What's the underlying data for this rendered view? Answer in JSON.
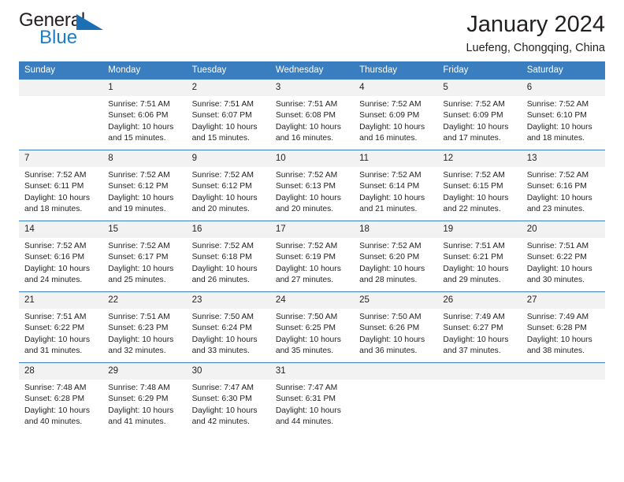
{
  "brand": {
    "name_part1": "General",
    "name_part2": "Blue",
    "accent_color": "#1f7dc4"
  },
  "header": {
    "title": "January 2024",
    "subtitle": "Luefeng, Chongqing, China"
  },
  "calendar": {
    "header_bg": "#3a7ebf",
    "daynum_bg": "#f2f2f2",
    "weekdays": [
      "Sunday",
      "Monday",
      "Tuesday",
      "Wednesday",
      "Thursday",
      "Friday",
      "Saturday"
    ],
    "weeks": [
      [
        {
          "day": "",
          "sunrise": "",
          "sunset": "",
          "daylight1": "",
          "daylight2": ""
        },
        {
          "day": "1",
          "sunrise": "Sunrise: 7:51 AM",
          "sunset": "Sunset: 6:06 PM",
          "daylight1": "Daylight: 10 hours",
          "daylight2": "and 15 minutes."
        },
        {
          "day": "2",
          "sunrise": "Sunrise: 7:51 AM",
          "sunset": "Sunset: 6:07 PM",
          "daylight1": "Daylight: 10 hours",
          "daylight2": "and 15 minutes."
        },
        {
          "day": "3",
          "sunrise": "Sunrise: 7:51 AM",
          "sunset": "Sunset: 6:08 PM",
          "daylight1": "Daylight: 10 hours",
          "daylight2": "and 16 minutes."
        },
        {
          "day": "4",
          "sunrise": "Sunrise: 7:52 AM",
          "sunset": "Sunset: 6:09 PM",
          "daylight1": "Daylight: 10 hours",
          "daylight2": "and 16 minutes."
        },
        {
          "day": "5",
          "sunrise": "Sunrise: 7:52 AM",
          "sunset": "Sunset: 6:09 PM",
          "daylight1": "Daylight: 10 hours",
          "daylight2": "and 17 minutes."
        },
        {
          "day": "6",
          "sunrise": "Sunrise: 7:52 AM",
          "sunset": "Sunset: 6:10 PM",
          "daylight1": "Daylight: 10 hours",
          "daylight2": "and 18 minutes."
        }
      ],
      [
        {
          "day": "7",
          "sunrise": "Sunrise: 7:52 AM",
          "sunset": "Sunset: 6:11 PM",
          "daylight1": "Daylight: 10 hours",
          "daylight2": "and 18 minutes."
        },
        {
          "day": "8",
          "sunrise": "Sunrise: 7:52 AM",
          "sunset": "Sunset: 6:12 PM",
          "daylight1": "Daylight: 10 hours",
          "daylight2": "and 19 minutes."
        },
        {
          "day": "9",
          "sunrise": "Sunrise: 7:52 AM",
          "sunset": "Sunset: 6:12 PM",
          "daylight1": "Daylight: 10 hours",
          "daylight2": "and 20 minutes."
        },
        {
          "day": "10",
          "sunrise": "Sunrise: 7:52 AM",
          "sunset": "Sunset: 6:13 PM",
          "daylight1": "Daylight: 10 hours",
          "daylight2": "and 20 minutes."
        },
        {
          "day": "11",
          "sunrise": "Sunrise: 7:52 AM",
          "sunset": "Sunset: 6:14 PM",
          "daylight1": "Daylight: 10 hours",
          "daylight2": "and 21 minutes."
        },
        {
          "day": "12",
          "sunrise": "Sunrise: 7:52 AM",
          "sunset": "Sunset: 6:15 PM",
          "daylight1": "Daylight: 10 hours",
          "daylight2": "and 22 minutes."
        },
        {
          "day": "13",
          "sunrise": "Sunrise: 7:52 AM",
          "sunset": "Sunset: 6:16 PM",
          "daylight1": "Daylight: 10 hours",
          "daylight2": "and 23 minutes."
        }
      ],
      [
        {
          "day": "14",
          "sunrise": "Sunrise: 7:52 AM",
          "sunset": "Sunset: 6:16 PM",
          "daylight1": "Daylight: 10 hours",
          "daylight2": "and 24 minutes."
        },
        {
          "day": "15",
          "sunrise": "Sunrise: 7:52 AM",
          "sunset": "Sunset: 6:17 PM",
          "daylight1": "Daylight: 10 hours",
          "daylight2": "and 25 minutes."
        },
        {
          "day": "16",
          "sunrise": "Sunrise: 7:52 AM",
          "sunset": "Sunset: 6:18 PM",
          "daylight1": "Daylight: 10 hours",
          "daylight2": "and 26 minutes."
        },
        {
          "day": "17",
          "sunrise": "Sunrise: 7:52 AM",
          "sunset": "Sunset: 6:19 PM",
          "daylight1": "Daylight: 10 hours",
          "daylight2": "and 27 minutes."
        },
        {
          "day": "18",
          "sunrise": "Sunrise: 7:52 AM",
          "sunset": "Sunset: 6:20 PM",
          "daylight1": "Daylight: 10 hours",
          "daylight2": "and 28 minutes."
        },
        {
          "day": "19",
          "sunrise": "Sunrise: 7:51 AM",
          "sunset": "Sunset: 6:21 PM",
          "daylight1": "Daylight: 10 hours",
          "daylight2": "and 29 minutes."
        },
        {
          "day": "20",
          "sunrise": "Sunrise: 7:51 AM",
          "sunset": "Sunset: 6:22 PM",
          "daylight1": "Daylight: 10 hours",
          "daylight2": "and 30 minutes."
        }
      ],
      [
        {
          "day": "21",
          "sunrise": "Sunrise: 7:51 AM",
          "sunset": "Sunset: 6:22 PM",
          "daylight1": "Daylight: 10 hours",
          "daylight2": "and 31 minutes."
        },
        {
          "day": "22",
          "sunrise": "Sunrise: 7:51 AM",
          "sunset": "Sunset: 6:23 PM",
          "daylight1": "Daylight: 10 hours",
          "daylight2": "and 32 minutes."
        },
        {
          "day": "23",
          "sunrise": "Sunrise: 7:50 AM",
          "sunset": "Sunset: 6:24 PM",
          "daylight1": "Daylight: 10 hours",
          "daylight2": "and 33 minutes."
        },
        {
          "day": "24",
          "sunrise": "Sunrise: 7:50 AM",
          "sunset": "Sunset: 6:25 PM",
          "daylight1": "Daylight: 10 hours",
          "daylight2": "and 35 minutes."
        },
        {
          "day": "25",
          "sunrise": "Sunrise: 7:50 AM",
          "sunset": "Sunset: 6:26 PM",
          "daylight1": "Daylight: 10 hours",
          "daylight2": "and 36 minutes."
        },
        {
          "day": "26",
          "sunrise": "Sunrise: 7:49 AM",
          "sunset": "Sunset: 6:27 PM",
          "daylight1": "Daylight: 10 hours",
          "daylight2": "and 37 minutes."
        },
        {
          "day": "27",
          "sunrise": "Sunrise: 7:49 AM",
          "sunset": "Sunset: 6:28 PM",
          "daylight1": "Daylight: 10 hours",
          "daylight2": "and 38 minutes."
        }
      ],
      [
        {
          "day": "28",
          "sunrise": "Sunrise: 7:48 AM",
          "sunset": "Sunset: 6:28 PM",
          "daylight1": "Daylight: 10 hours",
          "daylight2": "and 40 minutes."
        },
        {
          "day": "29",
          "sunrise": "Sunrise: 7:48 AM",
          "sunset": "Sunset: 6:29 PM",
          "daylight1": "Daylight: 10 hours",
          "daylight2": "and 41 minutes."
        },
        {
          "day": "30",
          "sunrise": "Sunrise: 7:47 AM",
          "sunset": "Sunset: 6:30 PM",
          "daylight1": "Daylight: 10 hours",
          "daylight2": "and 42 minutes."
        },
        {
          "day": "31",
          "sunrise": "Sunrise: 7:47 AM",
          "sunset": "Sunset: 6:31 PM",
          "daylight1": "Daylight: 10 hours",
          "daylight2": "and 44 minutes."
        },
        {
          "day": "",
          "sunrise": "",
          "sunset": "",
          "daylight1": "",
          "daylight2": ""
        },
        {
          "day": "",
          "sunrise": "",
          "sunset": "",
          "daylight1": "",
          "daylight2": ""
        },
        {
          "day": "",
          "sunrise": "",
          "sunset": "",
          "daylight1": "",
          "daylight2": ""
        }
      ]
    ]
  }
}
